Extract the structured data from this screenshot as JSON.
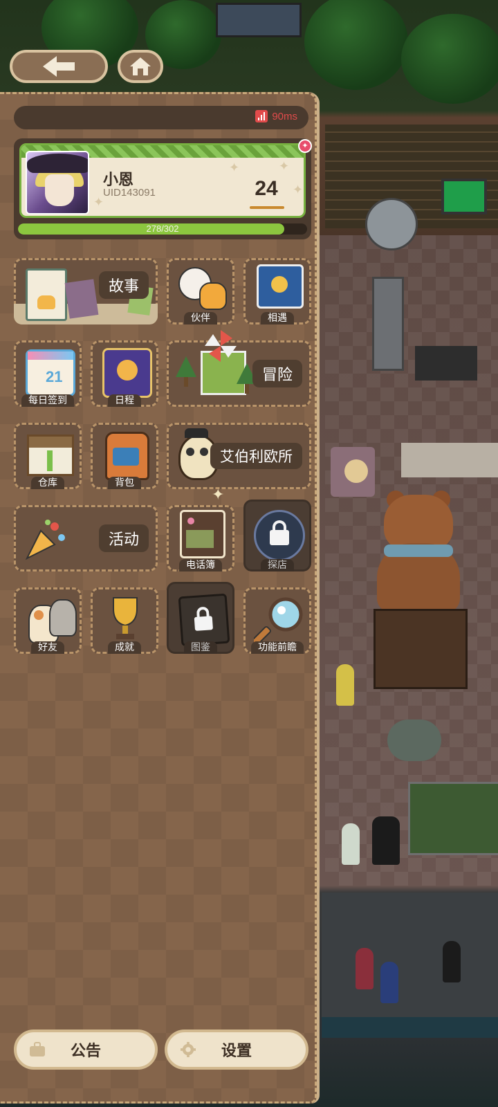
{
  "header": {
    "back_icon": "arrow-left-icon",
    "home_icon": "home-icon"
  },
  "status": {
    "ping": "90ms",
    "ping_icon": "signal-bars-icon",
    "ping_color": "#e14b4b"
  },
  "profile": {
    "name": "小恩",
    "uid": "UID143091",
    "level": "24",
    "xp_text": "278/302",
    "xp_fraction": 0.92,
    "notification_badge": "✦"
  },
  "menu": {
    "story": "故事",
    "partner": "伙伴",
    "encounter": "相遇",
    "daily_checkin": "每日签到",
    "calendar_day": "21",
    "schedule": "日程",
    "adventure": "冒险",
    "warehouse": "仓库",
    "backpack": "背包",
    "office": "艾伯利欧所",
    "activity": "活动",
    "phonebook": "电话簿",
    "explore_shop": "探店",
    "friends": "好友",
    "achievements": "成就",
    "collection": "图鉴",
    "preview": "功能前瞻"
  },
  "footer": {
    "announcement": "公告",
    "settings": "设置"
  },
  "colors": {
    "panel": "#85654b",
    "accent_green": "#8cc63f",
    "button_cream": "#efe3cb"
  }
}
